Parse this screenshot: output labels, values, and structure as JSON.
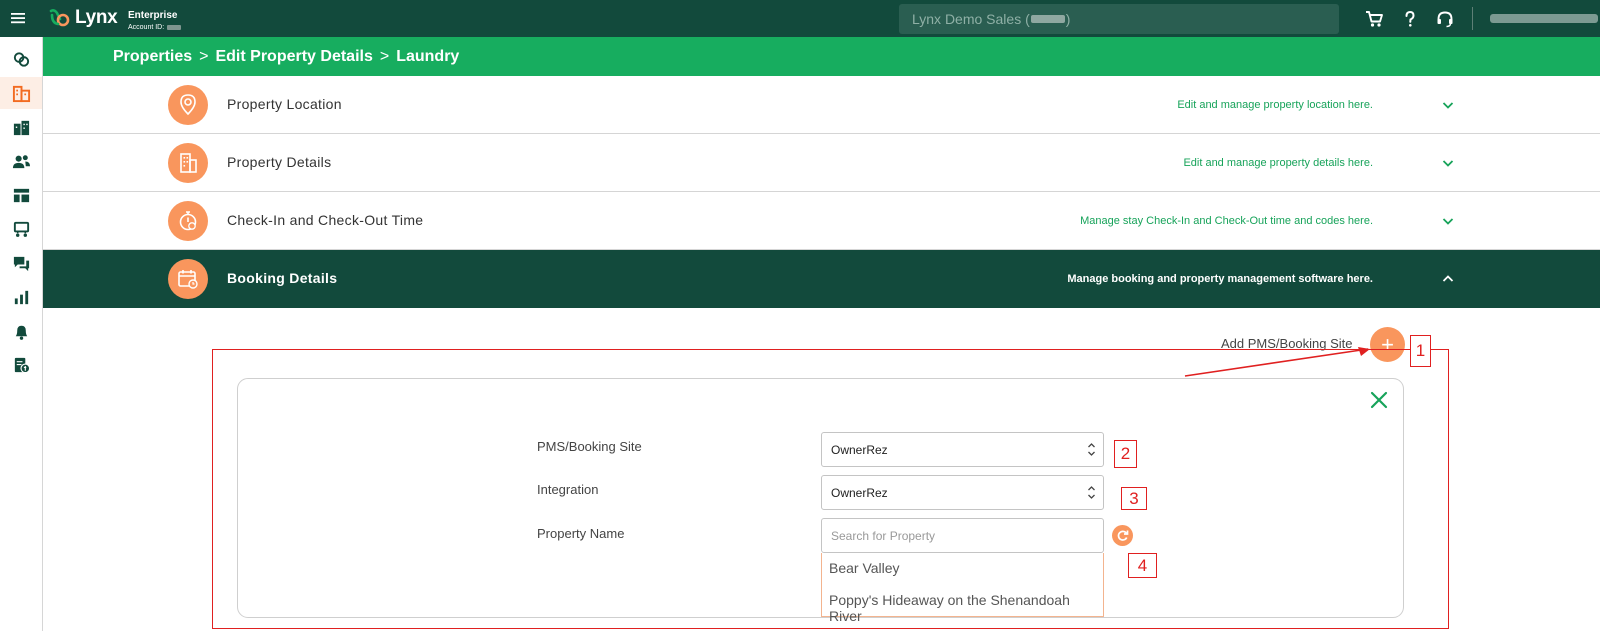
{
  "topbar": {
    "brand": "Lynx",
    "org_name": "Enterprise",
    "account_label": "Account ID:",
    "search_value": "Lynx Demo Sales (",
    "search_suffix": ")"
  },
  "breadcrumb": {
    "items": [
      "Properties",
      "Edit Property Details",
      "Laundry"
    ],
    "separator": ">"
  },
  "accordion": [
    {
      "title": "Property Location",
      "description": "Edit and manage property location here."
    },
    {
      "title": "Property Details",
      "description": "Edit and manage property details here."
    },
    {
      "title": "Check-In and Check-Out Time",
      "description": "Manage stay Check-In and Check-Out time and codes here."
    },
    {
      "title": "Booking Details",
      "description": "Manage booking and property management software here."
    }
  ],
  "booking": {
    "add_label": "Add PMS/Booking Site",
    "add_button": "+",
    "pms_label": "PMS/Booking Site",
    "pms_value": "OwnerRez",
    "integration_label": "Integration",
    "integration_value": "OwnerRez",
    "property_label": "Property Name",
    "property_placeholder": "Search for Property",
    "options": [
      "Bear Valley",
      "Poppy's Hideaway on the Shenandoah River"
    ]
  },
  "annotations": [
    "1",
    "2",
    "3",
    "4"
  ],
  "colors": {
    "topbar": "#124a3c",
    "accent_green": "#17ad5f",
    "accent_orange": "#f9965d",
    "annotation_red": "#e02020"
  }
}
